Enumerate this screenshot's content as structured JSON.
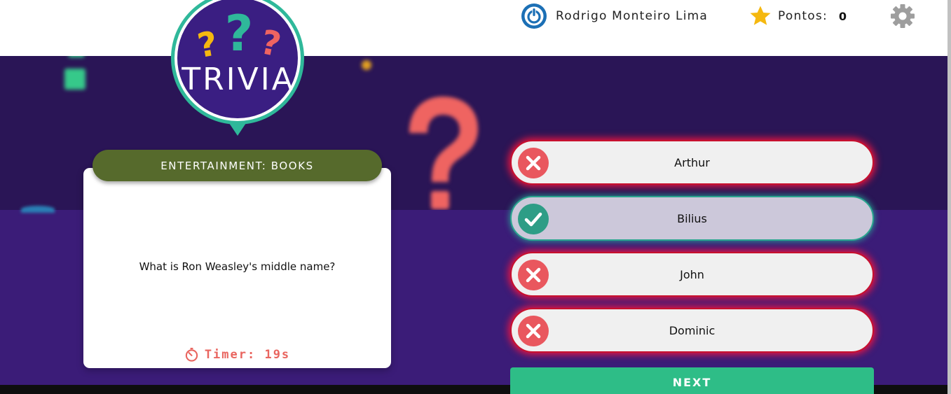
{
  "header": {
    "user_name": "Rodrigo Monteiro Lima",
    "points_label": "Pontos:",
    "points_value": "0",
    "icons": [
      "power-icon",
      "star-icon",
      "gear-icon"
    ]
  },
  "logo": {
    "text": "TRIVIA"
  },
  "question_card": {
    "category": "ENTERTAINMENT: BOOKS",
    "question": "What is Ron Weasley's middle name?",
    "timer": "Timer: 19s"
  },
  "answers": [
    {
      "label": "Arthur",
      "status": "wrong"
    },
    {
      "label": "Bilius",
      "status": "correct"
    },
    {
      "label": "John",
      "status": "wrong"
    },
    {
      "label": "Dominic",
      "status": "wrong"
    }
  ],
  "next_label": "NEXT",
  "colors": {
    "banner": "#2a1556",
    "main_bg": "#3b1c78",
    "category": "#566a2c",
    "correct": "#2aa58f",
    "wrong": "#e9575e",
    "next": "#2ebd87",
    "timer": "#e9655f"
  }
}
